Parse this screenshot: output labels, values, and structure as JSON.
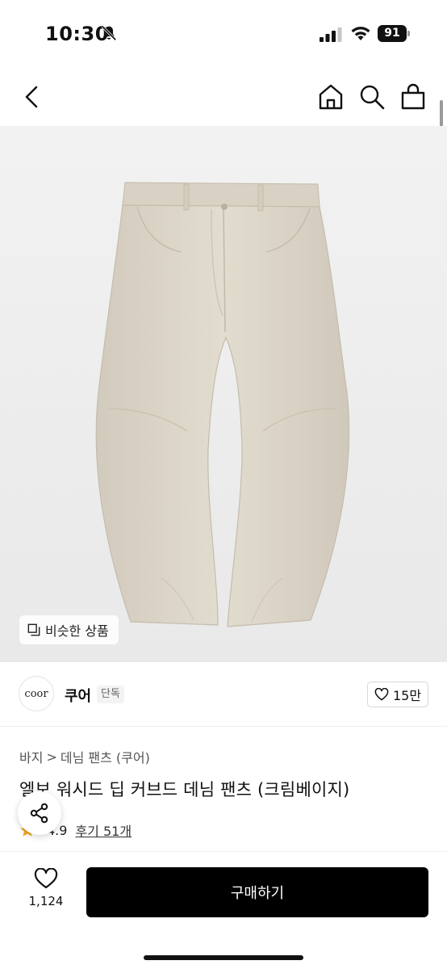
{
  "status_bar": {
    "time": "10:30",
    "battery": "91"
  },
  "product": {
    "similar_label": "비슷한 상품",
    "brand": {
      "logo_text": "coor",
      "name": "쿠어",
      "badge": "단독",
      "likes": "15만"
    },
    "breadcrumb": {
      "category": "바지",
      "separator": ">",
      "subcategory": "데님 팬츠 (쿠어)"
    },
    "title": "엘보 워시드 딥 커브드 데님 팬츠 (크림베이지)",
    "rating": "4.9",
    "reviews": "후기 51개"
  },
  "bottom_bar": {
    "wish_count": "1,124",
    "buy_label": "구매하기"
  },
  "colors": {
    "accent_star": "#f5a623",
    "buy_button": "#000000",
    "pants": "#ddd6c9"
  },
  "icons": [
    "bell-slash-icon",
    "signal-icon",
    "wifi-icon",
    "battery-icon",
    "back-icon",
    "home-icon",
    "search-icon",
    "bag-icon",
    "copy-icon",
    "heart-icon",
    "share-icon",
    "star-icon"
  ]
}
